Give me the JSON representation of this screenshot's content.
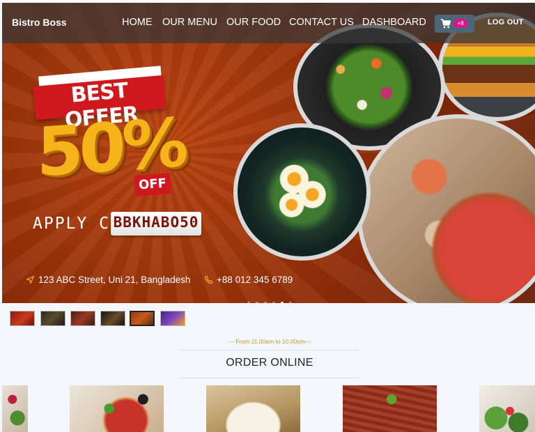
{
  "app": {
    "brand": "Bistro Boss"
  },
  "nav": {
    "links": [
      "HOME",
      "OUR MENU",
      "OUR FOOD",
      "CONTACT US",
      "DASHBOARD"
    ],
    "cart_badge": "+8",
    "logout_label": "LOG OUT"
  },
  "hero": {
    "offer_title": "BEST OFFER",
    "offer_percent": "50%",
    "offer_off": "OFF",
    "apply_label": "APPLY CODE",
    "code": "BBKHABO50",
    "address": "123 ABC Street, Uni 21, Bangladesh",
    "phone": "+88 012 345 6789",
    "slide_count": 6,
    "active_slide": 5
  },
  "thumbnails": {
    "count": 6,
    "active": 5
  },
  "section": {
    "subheading": "--- From 11.00am to 10.00pm---",
    "heading": "ORDER ONLINE"
  },
  "icons": {
    "cart": "cart-icon",
    "location": "location-arrow-icon",
    "phone": "phone-icon"
  },
  "colors": {
    "accent_badge": "#e0148a",
    "gold": "#c49a2b",
    "offer_red": "#d0181f"
  }
}
